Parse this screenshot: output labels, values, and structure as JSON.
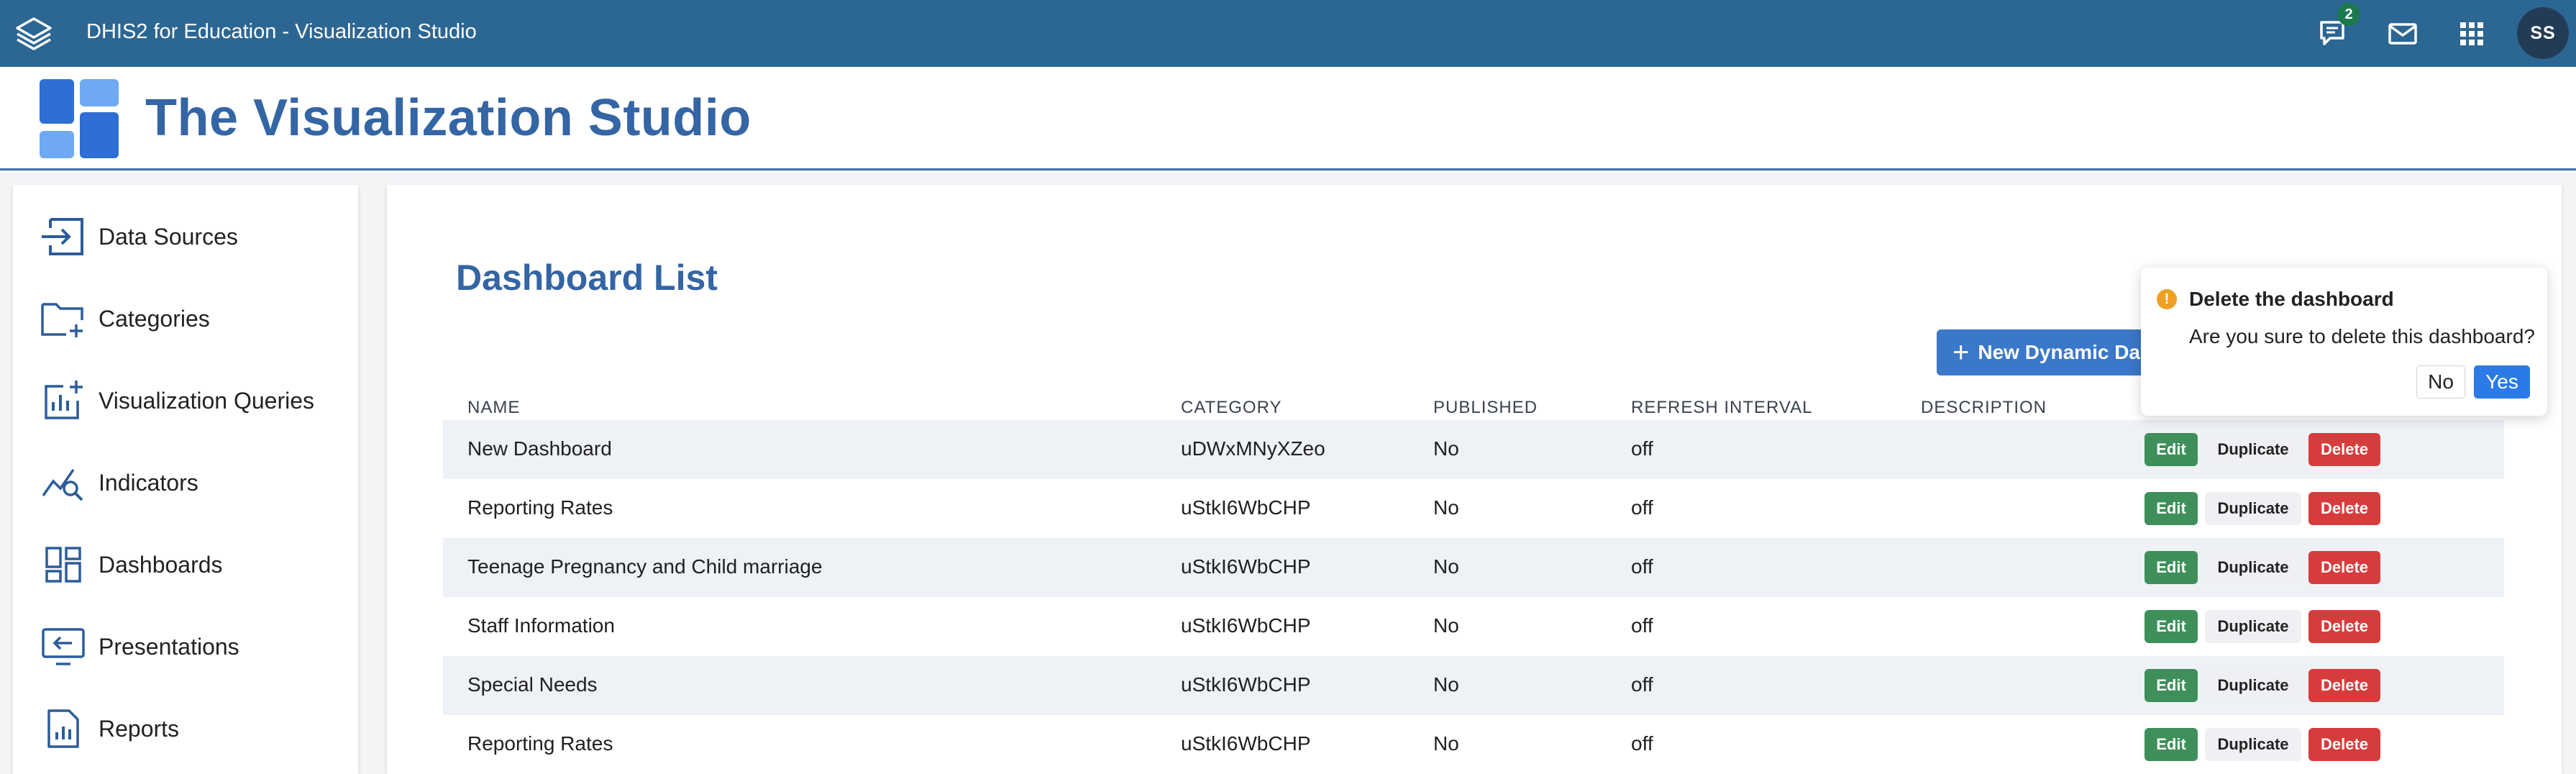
{
  "header": {
    "app_title": "DHIS2 for Education - Visualization Studio",
    "messages_badge": "2",
    "avatar_initials": "SS",
    "icons": [
      "dhis2-logo-icon",
      "interpretations-icon",
      "messages-icon",
      "apps-grid-icon"
    ]
  },
  "studio": {
    "title": "The Visualization Studio"
  },
  "sidebar": {
    "items": [
      {
        "label": "Data Sources",
        "icon": "data-sources-icon"
      },
      {
        "label": "Categories",
        "icon": "categories-icon"
      },
      {
        "label": "Visualization Queries",
        "icon": "visualization-queries-icon"
      },
      {
        "label": "Indicators",
        "icon": "indicators-icon"
      },
      {
        "label": "Dashboards",
        "icon": "dashboards-icon"
      },
      {
        "label": "Presentations",
        "icon": "presentations-icon"
      },
      {
        "label": "Reports",
        "icon": "reports-icon"
      }
    ]
  },
  "main": {
    "title": "Dashboard List",
    "new_button_label": "New Dynamic Da",
    "columns": [
      "NAME",
      "CATEGORY",
      "PUBLISHED",
      "REFRESH INTERVAL",
      "DESCRIPTION"
    ],
    "rows": [
      {
        "name": "New Dashboard",
        "category": "uDWxMNyXZeo",
        "published": "No",
        "refresh": "off",
        "description": ""
      },
      {
        "name": "Reporting Rates",
        "category": "uStkI6WbCHP",
        "published": "No",
        "refresh": "off",
        "description": ""
      },
      {
        "name": "Teenage Pregnancy and Child marriage",
        "category": "uStkI6WbCHP",
        "published": "No",
        "refresh": "off",
        "description": ""
      },
      {
        "name": "Staff Information",
        "category": "uStkI6WbCHP",
        "published": "No",
        "refresh": "off",
        "description": ""
      },
      {
        "name": "Special Needs",
        "category": "uStkI6WbCHP",
        "published": "No",
        "refresh": "off",
        "description": ""
      },
      {
        "name": "Reporting Rates",
        "category": "uStkI6WbCHP",
        "published": "No",
        "refresh": "off",
        "description": ""
      }
    ],
    "actions": {
      "edit": "Edit",
      "duplicate": "Duplicate",
      "delete": "Delete"
    }
  },
  "popconfirm": {
    "title": "Delete the dashboard",
    "message": "Are you sure to delete this dashboard?",
    "no_label": "No",
    "yes_label": "Yes"
  },
  "colors": {
    "topbar": "#2c6693",
    "brand_blue": "#3465a4",
    "edit_green": "#3e8f5a",
    "delete_red": "#d73c3c",
    "confirm_blue": "#2b7ae6"
  }
}
